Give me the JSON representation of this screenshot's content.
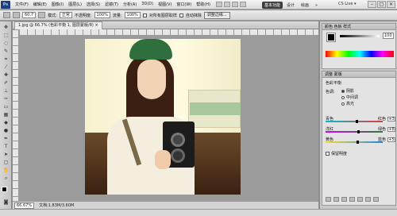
{
  "app": {
    "logo": "Ps"
  },
  "menu": {
    "items": [
      "文件(F)",
      "编辑(E)",
      "图像(I)",
      "图层(L)",
      "选择(S)",
      "滤镜(T)",
      "分析(A)",
      "3D(D)",
      "视图(V)",
      "窗口(W)",
      "帮助(H)"
    ]
  },
  "workspace": {
    "active": "基本功能",
    "items": [
      "设计",
      "绘画"
    ],
    "more": "»"
  },
  "cslive": "CS Live ▾",
  "window_buttons": [
    "–",
    "□",
    "×"
  ],
  "options_bar": {
    "brush_size": "60.7",
    "mode_label": "模式:",
    "mode_value": "正常",
    "opacity_label": "不透明度:",
    "opacity_value": "100%",
    "flow_label": "流量:",
    "flow_value": "100%",
    "airbrush": "对所有图层取样",
    "align_label": "自动抹除",
    "refine": "调整边缘..."
  },
  "document": {
    "tab_title": "1.jpg @ 66.7% (色彩平衡 1, 图层蒙版/8) ×",
    "zoom": "66.67%",
    "doc_info": "文档:1.83M/3.60M"
  },
  "panels": {
    "color_tab": "颜色  色板  样式",
    "slider_value": "100",
    "adjust_tab": "调整  蒙版",
    "adjust_title": "色彩平衡",
    "tone_label": "色调:",
    "tone_options": [
      "阴影",
      "中间调",
      "高光"
    ],
    "tone_selected": 0,
    "balance": [
      {
        "left": "青色",
        "right": "红色",
        "value": "+3"
      },
      {
        "left": "洋红",
        "right": "绿色",
        "value": "+8"
      },
      {
        "left": "黄色",
        "right": "蓝色",
        "value": "+5"
      }
    ],
    "preserve_luminosity": "保留明度"
  },
  "colors": {
    "accent_workspace": "#3d3d3d",
    "cyan_red_bar_left": "#00bcd4",
    "cyan_red_bar_right": "#e53935",
    "magenta_green_left": "#d500f9",
    "magenta_green_right": "#2e7d32",
    "yellow_blue_left": "#fdd835",
    "yellow_blue_right": "#1e88e5"
  }
}
